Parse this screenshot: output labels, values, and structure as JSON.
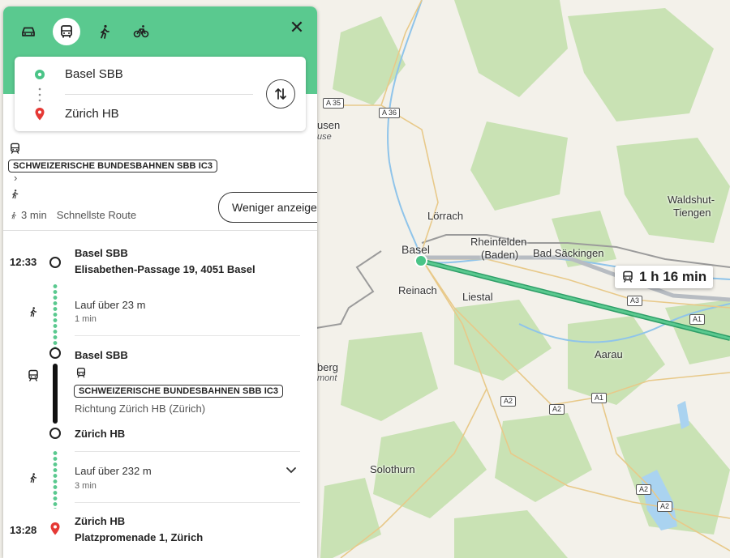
{
  "panel": {
    "modes": [
      {
        "name": "car",
        "active": false
      },
      {
        "name": "transit",
        "active": true
      },
      {
        "name": "walk",
        "active": false
      },
      {
        "name": "bike",
        "active": false
      }
    ],
    "close_symbol": "✕",
    "origin": "Basel SBB",
    "destination": "Zürich HB",
    "summary": {
      "operator": "SCHWEIZERISCHE BUNDESBAHNEN SBB IC3",
      "walk_time": "3 min",
      "route_label": "Schnellste Route",
      "less_button": "Weniger anzeigen"
    },
    "itinerary": {
      "start": {
        "time": "12:33",
        "name": "Basel SBB",
        "address": "Elisabethen-Passage 19, 4051 Basel"
      },
      "walk1": {
        "label": "Lauf über 23 m",
        "duration": "1 min"
      },
      "transit": {
        "from": "Basel SBB",
        "operator": "SCHWEIZERISCHE BUNDESBAHNEN SBB IC3",
        "direction": "Richtung Zürich HB (Zürich)",
        "to": "Zürich HB"
      },
      "walk2": {
        "label": "Lauf über 232 m",
        "duration": "3 min"
      },
      "end": {
        "time": "13:28",
        "name": "Zürich HB",
        "address": "Platzpromenade 1, Zürich"
      }
    }
  },
  "map": {
    "route_duration": "1 h 16 min",
    "labels": {
      "basel": "Basel",
      "loerrach": "Lörrach",
      "rheinfelden": "Rheinfelden",
      "rheinfelden_baden": "(Baden)",
      "bad_saeckingen": "Bad Säckingen",
      "reinach": "Reinach",
      "liestal": "Liestal",
      "waldshut": "Waldshut-",
      "tiengen": "Tiengen",
      "aarau": "Aarau",
      "solothurn": "Solothurn",
      "usen": "usen",
      "use": "use",
      "berg": "berg",
      "mont": "mont"
    },
    "shields": {
      "a35": "A 35",
      "a36": "A 36",
      "a3": "A3",
      "a1_top": "A1",
      "a2_left": "A2",
      "a2_mid": "A2",
      "a1_mid": "A1",
      "a2_right1": "A2",
      "a2_right2": "A2"
    },
    "colors": {
      "route": "#2e9e68",
      "accent": "#5ac98f",
      "destination_pin": "#e53935"
    }
  }
}
